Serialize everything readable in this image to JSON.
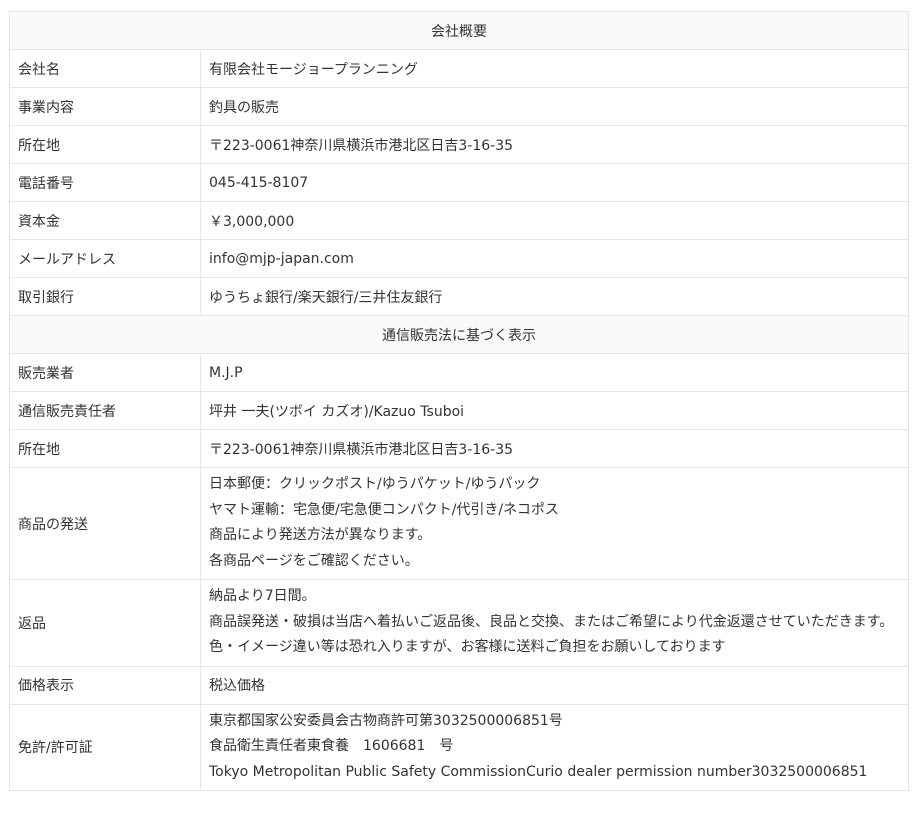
{
  "section1": {
    "title": "会社概要",
    "rows": [
      {
        "label": "会社名",
        "value": "有限会社モージョープランニング"
      },
      {
        "label": "事業内容",
        "value": "釣具の販売"
      },
      {
        "label": "所在地",
        "value": "〒223-0061神奈川県横浜市港北区日吉3-16-35"
      },
      {
        "label": "電話番号",
        "value": "045-415-8107"
      },
      {
        "label": "資本金",
        "value": "￥3,000,000"
      },
      {
        "label": "メールアドレス",
        "value": "info@mjp-japan.com"
      },
      {
        "label": "取引銀行",
        "value": "ゆうちょ銀行/楽天銀行/三井住友銀行"
      }
    ]
  },
  "section2": {
    "title": "通信販売法に基づく表示",
    "seller": {
      "label": "販売業者",
      "value": "M.J.P"
    },
    "manager": {
      "label": "通信販売責任者",
      "value": "坪井 一夫(ツボイ カズオ)/Kazuo Tsuboi"
    },
    "address": {
      "label": "所在地",
      "value": "〒223-0061神奈川県横浜市港北区日吉3-16-35"
    },
    "shipping": {
      "label": "商品の発送",
      "lines": [
        "日本郵便：クリックポスト/ゆうパケット/ゆうパック",
        "ヤマト運輸：宅急便/宅急便コンパクト/代引き/ネコポス",
        "商品により発送方法が異なります。",
        "各商品ページをご確認ください。"
      ]
    },
    "returns": {
      "label": "返品",
      "lines": [
        "納品より7日間。",
        "商品誤発送・破損は当店へ着払いご返品後、良品と交換、またはご希望により代金返還させていただきます。",
        "色・イメージ違い等は恐れ入りますが、お客様に送料ご負担をお願いしております"
      ]
    },
    "price": {
      "label": "価格表示",
      "value": "税込価格"
    },
    "license": {
      "label": "免許/許可証",
      "lines": [
        "東京都国家公安委員会古物商許可第3032500006851号",
        "食品衛生責任者東食養　1606681　号",
        "Tokyo Metropolitan Public Safety CommissionCurio dealer permission number3032500006851"
      ]
    }
  }
}
